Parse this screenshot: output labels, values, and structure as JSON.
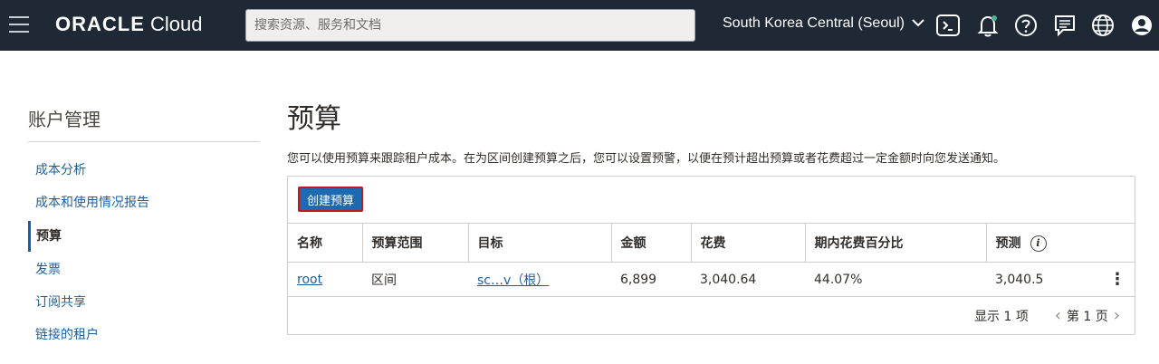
{
  "topbar": {
    "logo_bold": "ORACLE",
    "logo_light": " Cloud",
    "search_placeholder": "搜索资源、服务和文档",
    "region": "South Korea Central (Seoul)"
  },
  "sidebar": {
    "title": "账户管理",
    "items": [
      {
        "label": "成本分析"
      },
      {
        "label": "成本和使用情况报告"
      },
      {
        "label": "预算"
      },
      {
        "label": "发票"
      },
      {
        "label": "订阅共享"
      },
      {
        "label": "链接的租户"
      }
    ]
  },
  "main": {
    "title": "预算",
    "description": "您可以使用预算来跟踪租户成本。在为区间创建预算之后，您可以设置预警，以便在预计超出预算或者花费超过一定金额时向您发送通知。",
    "create_button": "创建预算",
    "table": {
      "headers": [
        "名称",
        "预算范围",
        "目标",
        "金额",
        "花费",
        "期内花费百分比",
        "预测"
      ],
      "rows": [
        {
          "name": "root",
          "scope": "区间",
          "target": "sc…v（根）",
          "amount": "6,899",
          "spent": "3,040.64",
          "percent": "44.07%",
          "forecast": "3,040.5"
        }
      ]
    },
    "pager": {
      "showing": "显示 1 项",
      "page": "第 1 页"
    }
  },
  "colors": {
    "topbar_bg": "#1e2935",
    "link": "#1d5f9e",
    "button_bg": "#1b6ab2",
    "button_highlight": "#c6171d"
  }
}
